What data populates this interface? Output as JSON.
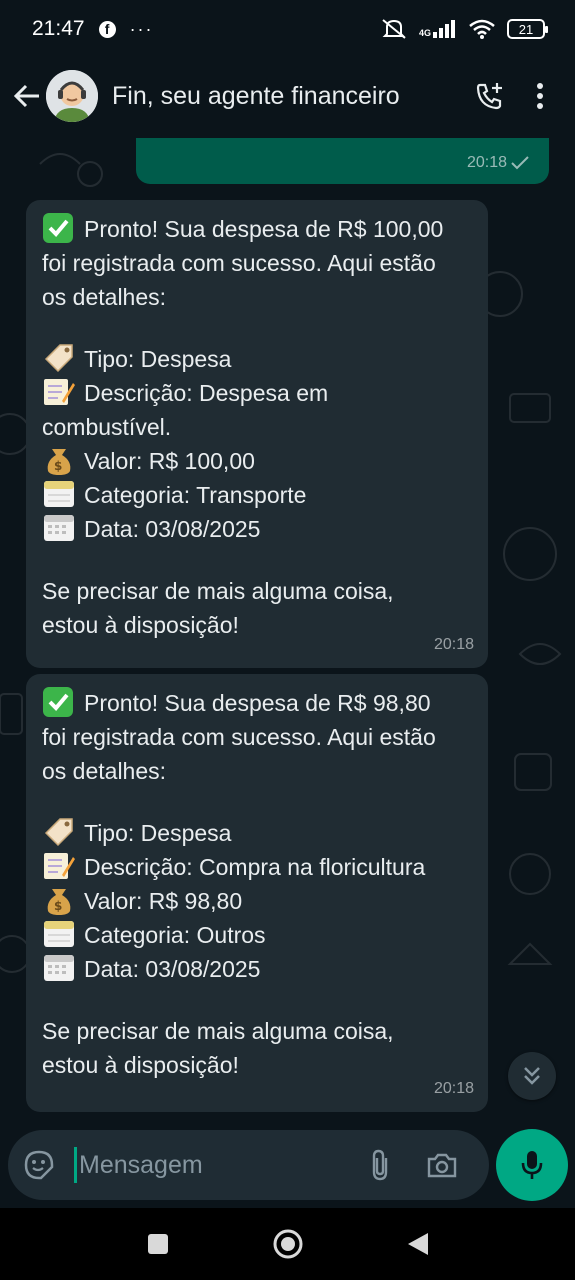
{
  "status_bar": {
    "time": "21:47",
    "more": "···",
    "network": "4G",
    "battery": "21"
  },
  "header": {
    "contact_name": "Fin, seu agente financeiro",
    "icons": [
      "back-arrow-icon",
      "avatar",
      "add-call-icon",
      "more-vert-icon"
    ]
  },
  "outgoing_message": {
    "time": "20:18",
    "status": "sent"
  },
  "messages": [
    {
      "line1": "Pronto! Sua despesa de R$ 100,00",
      "line2": "foi registrada com sucesso. Aqui estão",
      "line3": "os detalhes:",
      "tipo": "Tipo: Despesa",
      "descricao_a": "Descrição: Despesa em",
      "descricao_b": "combustível.",
      "valor": "Valor: R$ 100,00",
      "categoria": "Categoria: Transporte",
      "data": "Data: 03/08/2025",
      "closing1": "Se precisar de mais alguma coisa,",
      "closing2": "estou à disposição!",
      "time": "20:18"
    },
    {
      "line1": "Pronto! Sua despesa de R$ 98,80",
      "line2": "foi registrada com sucesso. Aqui estão",
      "line3": "os detalhes:",
      "tipo": "Tipo: Despesa",
      "descricao_a": "Descrição: Compra na floricultura",
      "valor": "Valor: R$ 98,80",
      "categoria": "Categoria: Outros",
      "data": "Data: 03/08/2025",
      "closing1": "Se precisar de mais alguma coisa,",
      "closing2": "estou à disposição!",
      "time": "20:18"
    }
  ],
  "composer": {
    "placeholder": "Mensagem"
  },
  "colors": {
    "background": "#0b141a",
    "incoming_bubble": "#202c33",
    "outgoing_bubble": "#005c4b",
    "accent": "#00a884"
  }
}
